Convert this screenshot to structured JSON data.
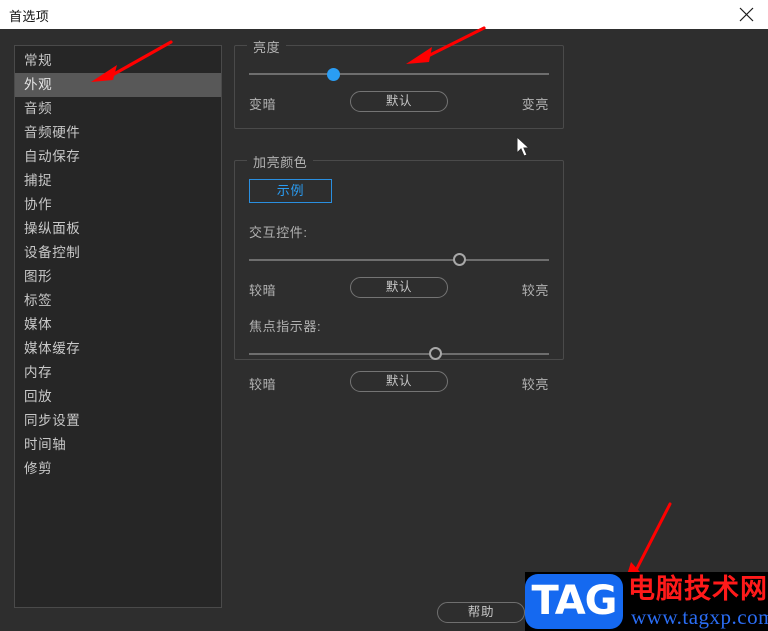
{
  "titlebar": {
    "title": "首选项",
    "close_icon": "close-icon"
  },
  "sidebar": {
    "items": [
      {
        "label": "常规",
        "selected": false
      },
      {
        "label": "外观",
        "selected": true
      },
      {
        "label": "音频",
        "selected": false
      },
      {
        "label": "音频硬件",
        "selected": false
      },
      {
        "label": "自动保存",
        "selected": false
      },
      {
        "label": "捕捉",
        "selected": false
      },
      {
        "label": "协作",
        "selected": false
      },
      {
        "label": "操纵面板",
        "selected": false
      },
      {
        "label": "设备控制",
        "selected": false
      },
      {
        "label": "图形",
        "selected": false
      },
      {
        "label": "标签",
        "selected": false
      },
      {
        "label": "媒体",
        "selected": false
      },
      {
        "label": "媒体缓存",
        "selected": false
      },
      {
        "label": "内存",
        "selected": false
      },
      {
        "label": "回放",
        "selected": false
      },
      {
        "label": "同步设置",
        "selected": false
      },
      {
        "label": "时间轴",
        "selected": false
      },
      {
        "label": "修剪",
        "selected": false
      }
    ]
  },
  "brightness_group": {
    "legend": "亮度",
    "slider": {
      "value_percent": 28
    },
    "left_label": "变暗",
    "default_label": "默认",
    "right_label": "变亮"
  },
  "highlight_group": {
    "legend": "加亮颜色",
    "sample_button": "示例",
    "interactive": {
      "label": "交互控件:",
      "slider": {
        "value_percent": 70
      },
      "left_label": "较暗",
      "default_label": "默认",
      "right_label": "较亮"
    },
    "focus": {
      "label": "焦点指示器:",
      "slider": {
        "value_percent": 62
      },
      "left_label": "较暗",
      "default_label": "默认",
      "right_label": "较亮"
    }
  },
  "footer": {
    "help_label": "帮助"
  },
  "watermark": {
    "tag": "TAG",
    "site_name": "电脑技术网",
    "url": "www.tagxp.com"
  },
  "colors": {
    "accent_blue": "#2a9df4",
    "annotation_red": "#ff0000",
    "selected_row": "#585858",
    "dialog_bg": "#2e2e2e",
    "sidebar_bg": "#262626"
  }
}
